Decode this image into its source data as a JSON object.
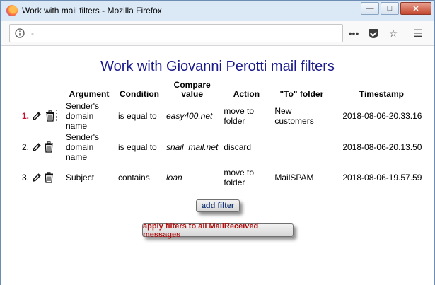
{
  "window": {
    "title": "Work with mail filters - Mozilla Firefox",
    "controls": {
      "minimize": "—",
      "maximize": "□",
      "close": "✕"
    }
  },
  "navbar": {
    "url": "-",
    "icons": [
      "info-icon",
      "more-icon",
      "pocket-icon",
      "bookmark-star-icon",
      "menu-icon"
    ]
  },
  "page": {
    "title": "Work with Giovanni Perotti mail filters",
    "columns": {
      "argument": "Argument",
      "condition": "Condition",
      "compare_value": "Compare value",
      "action": "Action",
      "to_folder": "\"To\" folder",
      "timestamp": "Timestamp"
    },
    "rows": [
      {
        "num": "1.",
        "argument": "Sender's domain name",
        "condition": "is equal to",
        "compare_value": "easy400.net",
        "action": "move to folder",
        "to_folder": "New customers",
        "timestamp": "2018-08-06-20.33.16"
      },
      {
        "num": "2.",
        "argument": "Sender's domain name",
        "condition": "is equal to",
        "compare_value": "snail_mail.net",
        "action": "discard",
        "to_folder": "",
        "timestamp": "2018-08-06-20.13.50"
      },
      {
        "num": "3.",
        "argument": "Subject",
        "condition": "contains",
        "compare_value": "loan",
        "action": "move to folder",
        "to_folder": "MailSPAM",
        "timestamp": "2018-08-06-19.57.59"
      }
    ],
    "add_filter_label": "add filter",
    "apply_filters_label": "apply filters to all MailReceived messages"
  },
  "colors": {
    "title": "#1a1a8c",
    "active_row_number": "#c8102e",
    "apply_button_text": "#b01010"
  }
}
